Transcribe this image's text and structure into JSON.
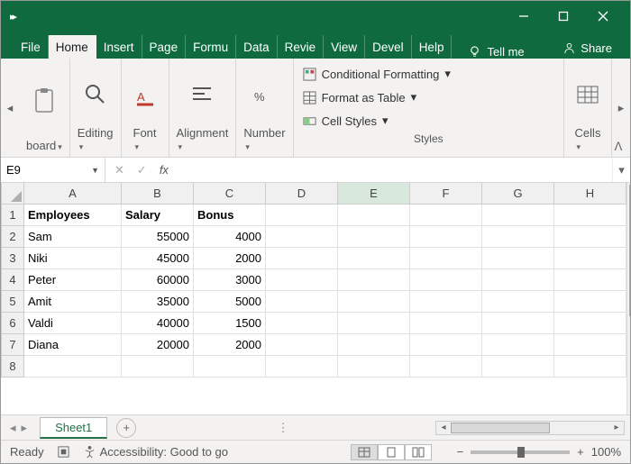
{
  "tabs": {
    "file": "File",
    "home": "Home",
    "insert": "Insert",
    "page": "Page",
    "formu": "Formu",
    "data": "Data",
    "revie": "Revie",
    "view": "View",
    "devel": "Devel",
    "help": "Help",
    "tellme": "Tell me",
    "share": "Share"
  },
  "ribbon": {
    "board": "board",
    "editing": "Editing",
    "font": "Font",
    "alignment": "Alignment",
    "number": "Number",
    "condfmt": "Conditional Formatting",
    "fmttable": "Format as Table",
    "cellstyles": "Cell Styles",
    "styles": "Styles",
    "cells": "Cells"
  },
  "namebox": "E9",
  "columns": [
    "A",
    "B",
    "C",
    "D",
    "E",
    "F",
    "G",
    "H"
  ],
  "rows": [
    "1",
    "2",
    "3",
    "4",
    "5",
    "6",
    "7",
    "8"
  ],
  "sheet": {
    "name": "Sheet1"
  },
  "status": {
    "ready": "Ready",
    "acc": "Accessibility: Good to go",
    "zoom": "100%"
  },
  "chart_data": {
    "type": "table",
    "headers": [
      "Employees",
      "Salary",
      "Bonus"
    ],
    "data": [
      [
        "Sam",
        55000,
        4000
      ],
      [
        "Niki",
        45000,
        2000
      ],
      [
        "Peter",
        60000,
        3000
      ],
      [
        "Amit",
        35000,
        5000
      ],
      [
        "Valdi",
        40000,
        1500
      ],
      [
        "Diana",
        20000,
        2000
      ]
    ]
  }
}
